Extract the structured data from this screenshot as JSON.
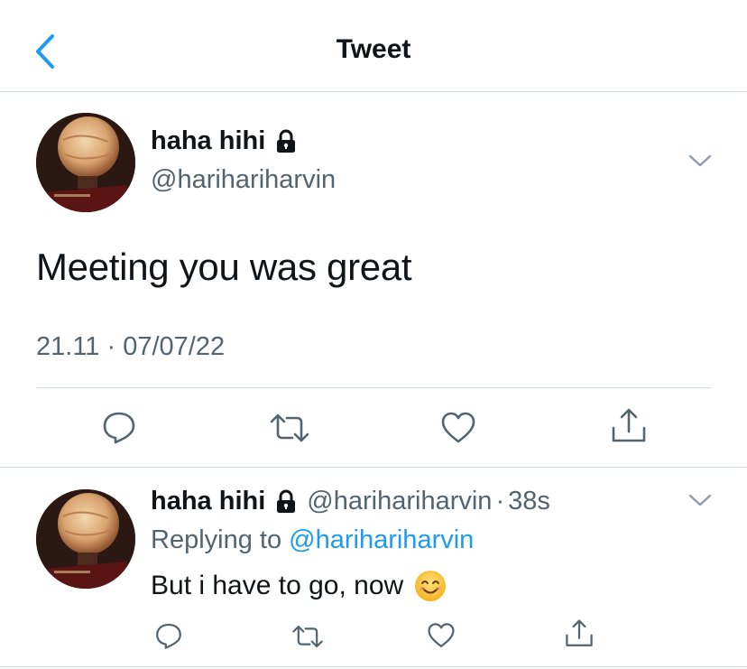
{
  "header": {
    "title": "Tweet"
  },
  "main_tweet": {
    "display_name": "haha hihi",
    "handle": "@harihariharvin",
    "text": "Meeting you was great",
    "timestamp": "21.11 · 07/07/22"
  },
  "reply": {
    "display_name": "haha hihi",
    "handle": "@harihariharvin",
    "separator": "·",
    "time_ago": "38s",
    "replying_prefix": "Replying to ",
    "replying_handle": "@harihariharvin",
    "text": "But i have to go, now"
  },
  "colors": {
    "accent": "#1d9bf0",
    "muted_text": "#536471",
    "divider": "#cfd9de",
    "icon": "#536471"
  },
  "icons": {
    "back": "chevron-left-icon",
    "lock": "lock-icon",
    "more": "chevron-down-icon",
    "reply": "comment-icon",
    "retweet": "retweet-icon",
    "like": "heart-icon",
    "share": "share-icon",
    "emoji": "smiling-face-emoji"
  }
}
